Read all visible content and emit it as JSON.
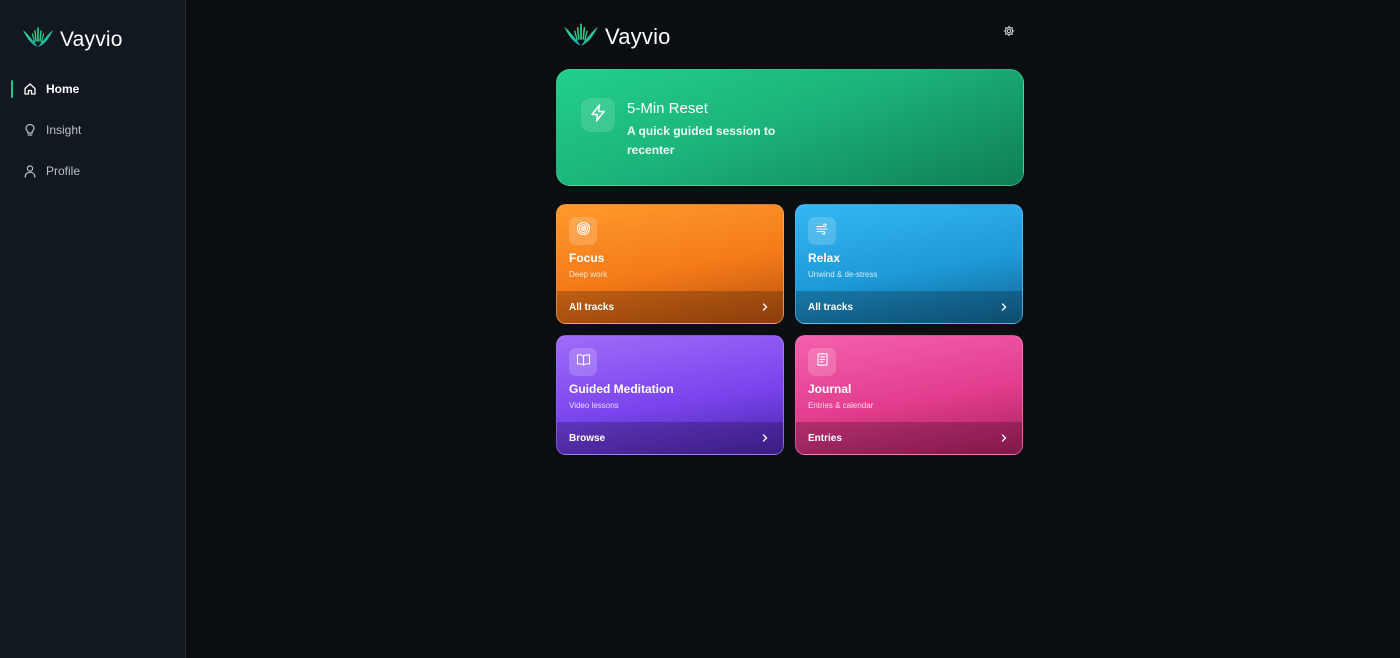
{
  "brand": {
    "name": "Vayvio",
    "accent": "#22c58b"
  },
  "sidebar": {
    "items": [
      {
        "label": "Home",
        "icon": "home-icon",
        "active": true
      },
      {
        "label": "Insight",
        "icon": "lightbulb-icon",
        "active": false
      },
      {
        "label": "Profile",
        "icon": "user-icon",
        "active": false
      }
    ]
  },
  "header": {
    "settings_icon": "gear-icon"
  },
  "hero": {
    "title": "5-Min Reset",
    "description": "A quick guided session to recenter",
    "icon": "lightning-icon",
    "color": "#22cf8b"
  },
  "cards": [
    {
      "title": "Focus",
      "subtitle": "Deep work",
      "footer": "All tracks",
      "icon": "target-icon",
      "color": "#f47a18"
    },
    {
      "title": "Relax",
      "subtitle": "Unwind & de-stress",
      "footer": "All tracks",
      "icon": "wind-icon",
      "color": "#1d9ad8"
    },
    {
      "title": "Guided Meditation",
      "subtitle": "Video lessons",
      "footer": "Browse",
      "icon": "book-icon",
      "color": "#7a44ee"
    },
    {
      "title": "Journal",
      "subtitle": "Entries & calendar",
      "footer": "Entries",
      "icon": "notebook-icon",
      "color": "#e23c8d"
    }
  ]
}
